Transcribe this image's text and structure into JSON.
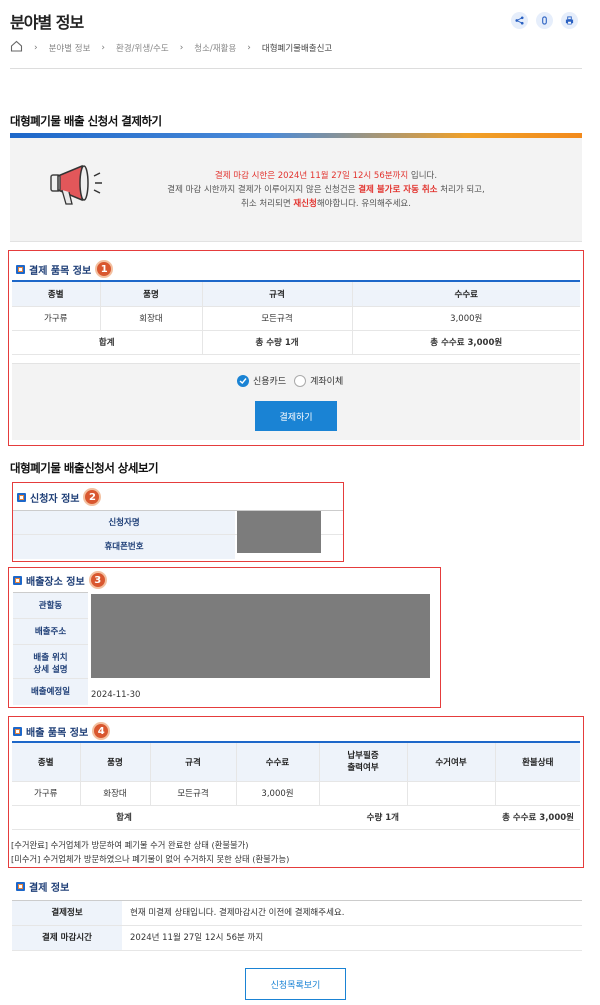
{
  "page_title": "분야별 정보",
  "tools": {
    "share_icon": "share-icon",
    "link_icon": "link-icon",
    "print_icon": "print-icon"
  },
  "breadcrumb": [
    "분야별 정보",
    "환경/위생/수도",
    "청소/재활용",
    "대형폐기물배출신고"
  ],
  "section_payment_title": "대형폐기물 배출 신청서 결제하기",
  "notice": {
    "l1_a": "결제 마감 시한은 2024년 11월 27일 12시 56분까지",
    "l1_b": " 입니다.",
    "l2_a": "결제 마감 시한까지 결제가 이루어지지 않은 신청건은 ",
    "l2_b": "결제 불가로 자동 취소",
    "l2_c": " 처리가 되고,",
    "l3_a": "취소 처리되면 ",
    "l3_b": "재신청",
    "l3_c": "해야합니다. 유의해주세요."
  },
  "pay_items": {
    "label": "결제 품목 정보",
    "badge": "1",
    "headers": [
      "종별",
      "품명",
      "규격",
      "수수료"
    ],
    "row": [
      "가구류",
      "회장대",
      "모든규격",
      "3,000원"
    ],
    "total": {
      "label": "합계",
      "qty": "총 수량 1개",
      "fee": "총 수수료 3,000원"
    },
    "methods": [
      "신용카드",
      "계좌이체"
    ],
    "pay_button": "결제하기"
  },
  "detail_title": "대형폐기물 배출신청서 상세보기",
  "applicant": {
    "label": "신청자 정보",
    "badge": "2",
    "name_label": "신청자명",
    "phone_label": "휴대폰번호"
  },
  "place": {
    "label": "배출장소 정보",
    "badge": "3",
    "rows": [
      "관할동",
      "배출주소",
      "배출 위치\n상세 설명",
      "배출예정일"
    ],
    "date": "2024-11-30"
  },
  "items": {
    "label": "배출 품목 정보",
    "badge": "4",
    "headers": [
      "종별",
      "품명",
      "규격",
      "수수료",
      "납부필증\n출력여부",
      "수거여부",
      "환불상태"
    ],
    "row": [
      "가구류",
      "화장대",
      "모든규격",
      "3,000원",
      "",
      "",
      ""
    ],
    "total": {
      "label": "합계",
      "qty": "수량 1개",
      "fee": "총 수수료 3,000원"
    },
    "notes": [
      "[수거완료] 수거업체가 방문하여 폐기물 수거 완료한 상태 (환불불가)",
      "[미수거] 수거업체가 방문하였으나 폐기물이 없어 수거하지 못한 상태 (환불가능)"
    ]
  },
  "payment": {
    "label": "결제 정보",
    "rows": [
      {
        "k": "결제정보",
        "v": "현재 미결제 상태입니다. 결제마감시간 이전에 결제해주세요."
      },
      {
        "k": "결제 마감시간",
        "v": "2024년 11월 27일 12시 56분 까지"
      }
    ]
  },
  "list_button": "신청목록보기",
  "colors": {
    "accent": "#1d67c9",
    "highlight": "#e53c3c",
    "button": "#1a83d4"
  }
}
